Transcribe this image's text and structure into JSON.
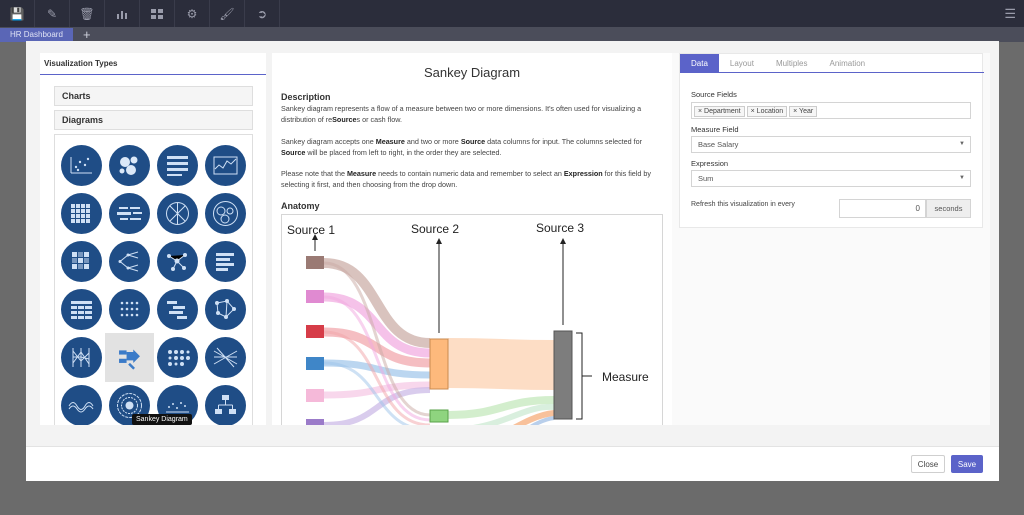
{
  "app": {
    "dashboard_tab": "HR Dashboard",
    "add_tab": "+"
  },
  "toolbar": {
    "icons": [
      "save-icon",
      "edit-icon",
      "trash-icon",
      "bar-chart-icon",
      "layout-icon",
      "gear-icon",
      "brush-icon",
      "logout-icon"
    ],
    "menu_icon": "hamburger-menu-icon"
  },
  "left_panel": {
    "title": "Visualization Types",
    "sections": {
      "charts": "Charts",
      "diagrams": "Diagrams"
    },
    "tooltip": "Sankey Diagram"
  },
  "middle_panel": {
    "title": "Sankey Diagram",
    "description_heading": "Description",
    "desc_p1_before": "Sankey diagram represents a flow of a measure between two or more dimensions. It's often used for visualizing a distribution of re",
    "desc_p1_bold": "Source",
    "desc_p1_after": "s or cash flow.",
    "desc_p2_a": "Sankey diagram accepts one ",
    "desc_p2_b": "Measure",
    "desc_p2_c": " and two or more ",
    "desc_p2_d": "Source",
    "desc_p2_e": " data columns for input. The columns selected for ",
    "desc_p2_f": "Source",
    "desc_p2_g": " will be placed from left to right, in the order they are selected.",
    "desc_p3_a": "Please note that the ",
    "desc_p3_b": "Measure",
    "desc_p3_c": " needs to contain numeric data and remember to select an ",
    "desc_p3_d": "Expression",
    "desc_p3_e": " for this field by selecting it first, and then choosing from the drop down.",
    "anatomy_heading": "Anatomy",
    "anatomy_labels": {
      "source1": "Source 1",
      "source2": "Source 2",
      "source3": "Source 3",
      "measure": "Measure"
    }
  },
  "right_panel": {
    "tabs": [
      "Data",
      "Layout",
      "Multiples",
      "Animation"
    ],
    "active_tab": "Data",
    "source_fields_label": "Source Fields",
    "source_fields": [
      "Department",
      "Location",
      "Year"
    ],
    "measure_field_label": "Measure Field",
    "measure_field_value": "Base Salary",
    "expression_label": "Expression",
    "expression_value": "Sum",
    "refresh_label": "Refresh this visualization in every",
    "refresh_value": "0",
    "refresh_unit": "seconds"
  },
  "footer": {
    "close_label": "Close",
    "save_label": "Save"
  },
  "colors": {
    "accent": "#5b63c9",
    "icon_blue": "#1f4d86",
    "topbar": "#2b2d3b"
  }
}
